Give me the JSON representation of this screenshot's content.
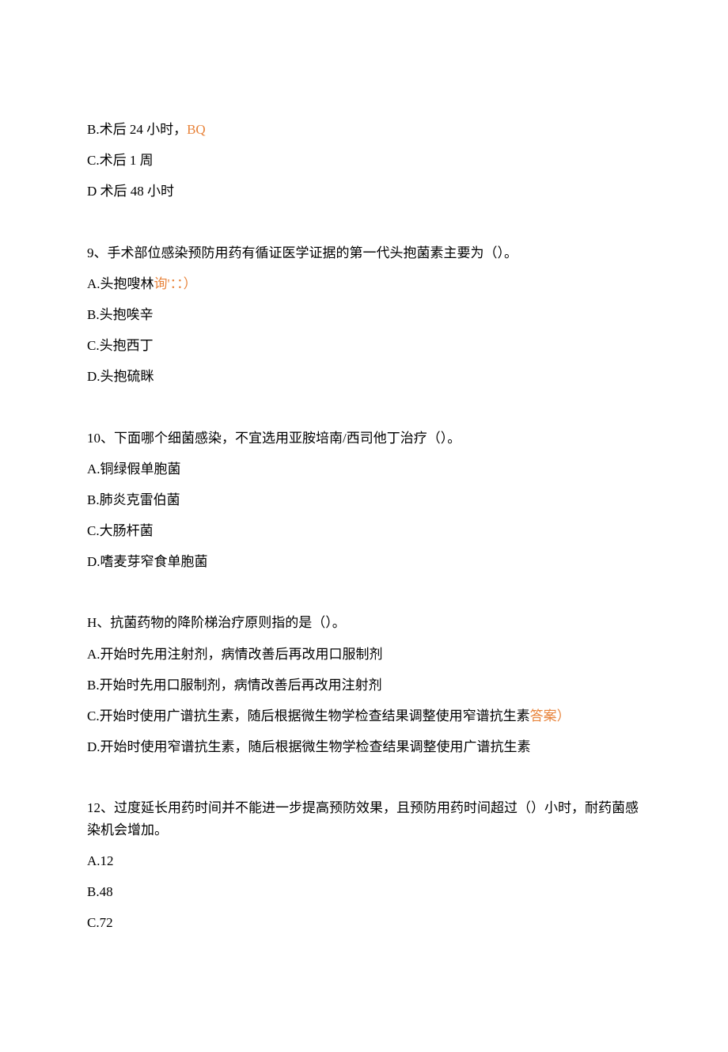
{
  "q8": {
    "optionB_pre": "B.术后 24 小时，",
    "optionB_orange": "BQ",
    "optionC": "C.术后 1 周",
    "optionD": "D 术后 48 小时"
  },
  "q9": {
    "stem": "9、手术部位感染预防用药有循证医学证据的第一代头抱菌素主要为（）。",
    "optionA_pre": "A.头抱嗖林",
    "optionA_orange": "询'：：）",
    "optionB": "B.头抱唉辛",
    "optionC": "C.头抱西丁",
    "optionD": "D.头抱硫眯"
  },
  "q10": {
    "stem": "10、下面哪个细菌感染，不宜选用亚胺培南/西司他丁治疗（）。",
    "optionA": "A.铜绿假单胞菌",
    "optionB": "B.肺炎克雷伯菌",
    "optionC": "C.大肠杆菌",
    "optionD": "D.嗜麦芽窄食单胞菌"
  },
  "q11": {
    "stem": "H、抗菌药物的降阶梯治疗原则指的是（）。",
    "optionA": "A.开始时先用注射剂，病情改善后再改用口服制剂",
    "optionB": "B.开始时先用口服制剂，病情改善后再改用注射剂",
    "optionC_pre": "C.开始时使用广谱抗生素，随后根据微生物学检查结果调整使用窄谱抗生素",
    "optionC_orange": "答案）",
    "optionD": "D.开始时使用窄谱抗生素，随后根据微生物学检查结果调整使用广谱抗生素"
  },
  "q12": {
    "stem": "12、过度延长用药时间并不能进一步提高预防效果，且预防用药时间超过（）小时，耐药菌感染机会增加。",
    "optionA": "A.12",
    "optionB": "B.48",
    "optionC": "C.72"
  }
}
